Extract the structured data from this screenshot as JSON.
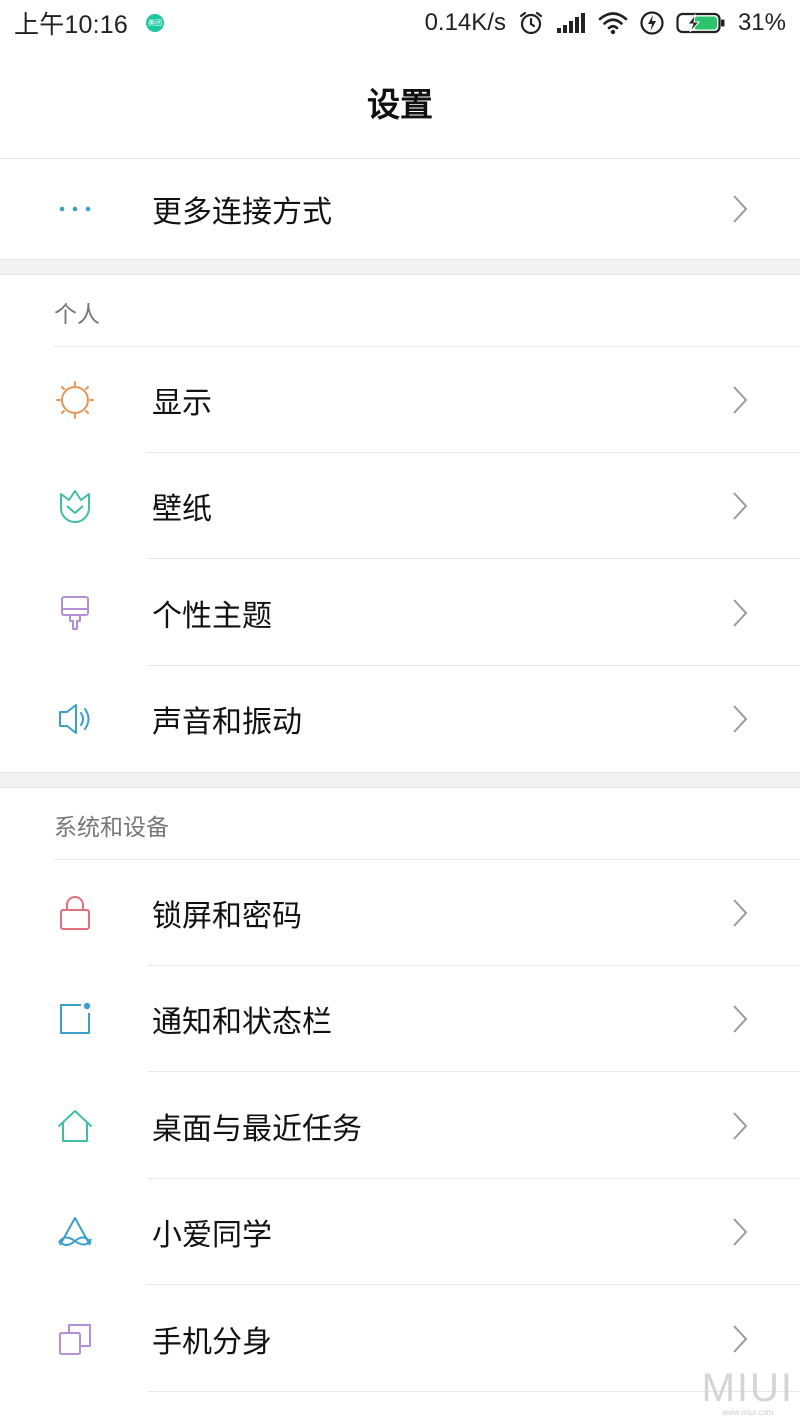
{
  "status_bar": {
    "time": "上午10:16",
    "app_badge": "美团",
    "network_speed": "0.14K/s",
    "battery": "31%",
    "icons": [
      "alarm-icon",
      "signal-icon",
      "wifi-icon",
      "charging-icon",
      "battery-icon"
    ]
  },
  "header": {
    "title": "设置"
  },
  "top_item": {
    "label": "更多连接方式",
    "icon": "more-icon"
  },
  "sections": [
    {
      "title": "个人",
      "items": [
        {
          "label": "显示",
          "icon": "sun-icon",
          "color": "#e8955a"
        },
        {
          "label": "壁纸",
          "icon": "tulip-icon",
          "color": "#3fbfa6"
        },
        {
          "label": "个性主题",
          "icon": "brush-icon",
          "color": "#b58fd6"
        },
        {
          "label": "声音和振动",
          "icon": "speaker-icon",
          "color": "#3a9fc9"
        }
      ]
    },
    {
      "title": "系统和设备",
      "items": [
        {
          "label": "锁屏和密码",
          "icon": "lock-icon",
          "color": "#e0707e"
        },
        {
          "label": "通知和状态栏",
          "icon": "notification-icon",
          "color": "#3a9fc9"
        },
        {
          "label": "桌面与最近任务",
          "icon": "home-icon",
          "color": "#3fbfa6"
        },
        {
          "label": "小爱同学",
          "icon": "xiaoai-icon",
          "color": "#3a9fc9"
        },
        {
          "label": "手机分身",
          "icon": "dual-phone-icon",
          "color": "#b58fd6"
        }
      ]
    }
  ],
  "watermark": {
    "brand": "MIUI",
    "site": "www.miui.com"
  }
}
